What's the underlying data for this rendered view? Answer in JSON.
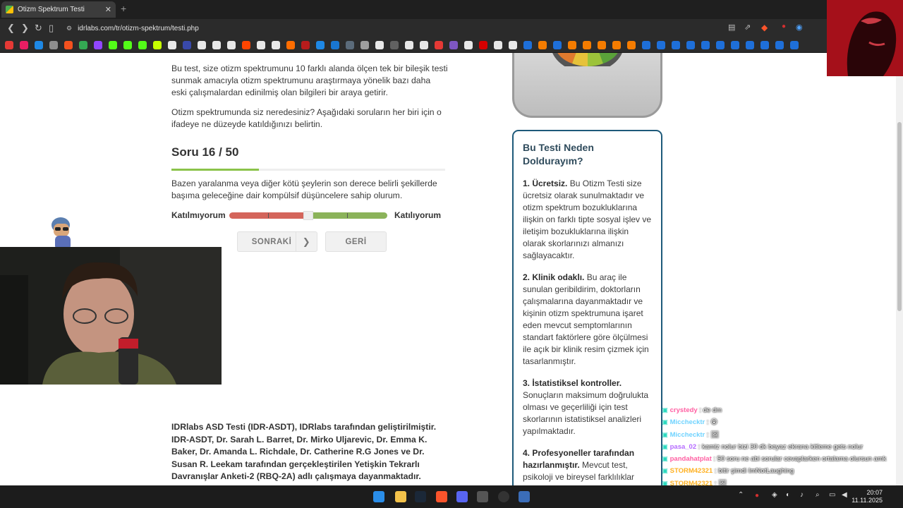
{
  "browser": {
    "tab_title": "Otizm Spektrum Testi",
    "tab_close": "✕",
    "new_tab": "+",
    "url": "idrlabs.com/tr/otizm-spektrum/testi.php"
  },
  "bookmark_colors": [
    "#e53935",
    "#e91e63",
    "#1e88e5",
    "#8e8e8e",
    "#f4511e",
    "#34a853",
    "#9146ff",
    "#53fc18",
    "#53fc18",
    "#53fc18",
    "#c6ff00",
    "#e8e8e8",
    "#3949ab",
    "#e8e8e8",
    "#e8e8e8",
    "#e8e8e8",
    "#ff4500",
    "#e8e8e8",
    "#e8e8e8",
    "#ff6d00",
    "#b71c1c",
    "#1e88e5",
    "#1976d2",
    "#5b6b7a",
    "#9e9e9e",
    "#e8e8e8",
    "#616161",
    "#e8e8e8",
    "#e8e8e8",
    "#e53935",
    "#7e57c2",
    "#e8e8e8",
    "#d50000",
    "#e8e8e8",
    "#e8e8e8",
    "#1e6fd9",
    "#f57c00",
    "#1e6fd9",
    "#f57c00",
    "#f57c00",
    "#f57c00",
    "#f57c00",
    "#f57c00",
    "#1e6fd9",
    "#1e6fd9",
    "#1e6fd9",
    "#1e6fd9",
    "#1e6fd9",
    "#1e6fd9",
    "#1e6fd9",
    "#1e6fd9",
    "#1e6fd9",
    "#1e6fd9",
    "#1e6fd9"
  ],
  "intro": {
    "p1": "Bu test, size otizm spektrumunu 10 farklı alanda ölçen tek bir bileşik testi sunmak amacıyla otizm spektrumunu araştırmaya yönelik bazı daha eski çalışmalardan edinilmiş olan bilgileri bir araya getirir.",
    "p2": "Otizm spektrumunda siz neredesiniz? Aşağıdaki soruların her biri için o ifadeye ne düzeyde katıldığınızı belirtin."
  },
  "question": {
    "title": "Soru 16 / 50",
    "progress": 0.32,
    "text": "Bazen yaralanma veya diğer kötü şeylerin son derece belirli şekillerde başıma geleceğine dair kompülsif düşüncelere sahip olurum.",
    "scale_left": "Katılmıyorum",
    "scale_right": "Katılıyorum",
    "next_label": "SONRAKİ",
    "back_label": "GERİ"
  },
  "credits": "IDRlabs ASD Testi (IDR-ASDT), IDRlabs tarafından geliştirilmiştir. IDR-ASDT, Dr. Sarah L. Barret, Dr. Mirko Uljarevic, Dr. Emma K. Baker, Dr. Amanda L. Richdale, Dr. Catherine R.G Jones ve Dr. Susan R. Leekam tarafından gerçekleştirilen Yetişkin Tekrarlı Davranışlar Anketi-2 (RBQ-2A) adlı çalışmaya dayanmaktadır.",
  "sidebar": {
    "heading": "Bu Testi Neden Doldurayım?",
    "items": [
      {
        "title": "1. Ücretsiz.",
        "body": "Bu Otizm Testi size ücretsiz olarak sunulmaktadır ve otizm spektrum bozukluklarına ilişkin on farklı tipte sosyal işlev ve iletişim bozukluklarına ilişkin olarak skorlarınızı almanızı sağlayacaktır."
      },
      {
        "title": "2. Klinik odaklı.",
        "body": "Bu araç ile sunulan geribildirim, doktorların çalışmalarına dayanmaktadır ve kişinin otizm spektrumuna işaret eden mevcut semptomlarının standart faktörlere göre ölçülmesi ile açık bir klinik resim çizmek için tasarlanmıştır."
      },
      {
        "title": "3. İstatistiksel kontroller.",
        "body": "Sonuçların maksimum doğrulukta olması ve geçerliliği için test skorlarının istatistiksel analizleri yapılmaktadır."
      },
      {
        "title": "4. Profesyoneller tarafından hazırlanmıştır.",
        "body": "Mevcut test, psikoloji ve bireysel farklılıklar alanlarında profesyonel çalışmalar"
      }
    ]
  },
  "chat": [
    {
      "name": "crystedy",
      "name_color": "#ff5fa2",
      "msg": "de dm"
    },
    {
      "name": "Micchecktr",
      "name_color": "#6fd3ff",
      "msg": "😮"
    },
    {
      "name": "Micchecktr",
      "name_color": "#6fd3ff",
      "msg": "🖼"
    },
    {
      "name": "pasa_02",
      "name_color": "#b56cff",
      "msg": "kamiz nolur bizi 30 dk beyaz ekrana kitleme gets nolur"
    },
    {
      "name": "pandahatplat",
      "name_color": "#ff5fa2",
      "msg": "50 soru ne abi sorular cevaplarken ortalama olursun amk"
    },
    {
      "name": "STORM42321",
      "name_color": "#ffb020",
      "msg": "bitir şimdi ImNotLaughing"
    },
    {
      "name": "STORM42321",
      "name_color": "#ffb020",
      "msg": "🖼"
    }
  ],
  "taskbar": {
    "time": "20:07",
    "date": "11.11.2025"
  }
}
